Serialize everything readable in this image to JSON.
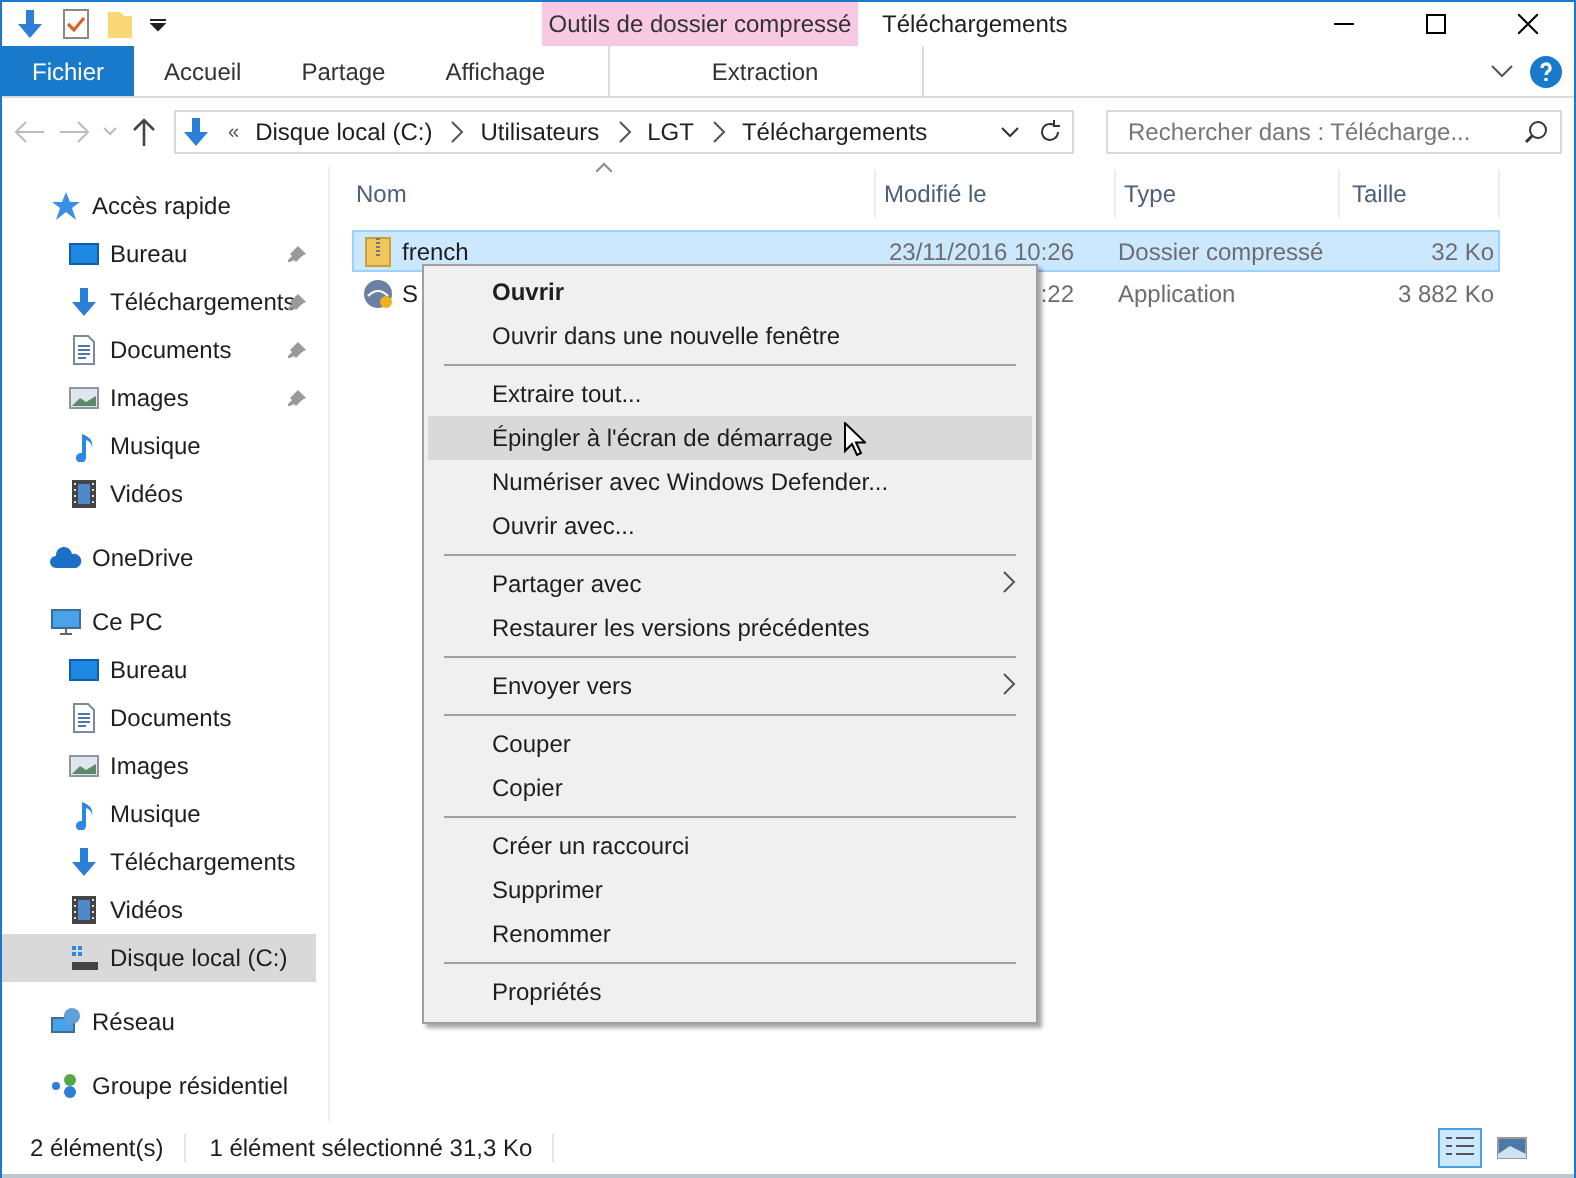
{
  "title_bar": {
    "context_group": "Outils de dossier compressé",
    "title": "Téléchargements"
  },
  "ribbon_tabs": [
    {
      "label": "Fichier",
      "kind": "file",
      "selected": false
    },
    {
      "label": "Accueil",
      "kind": "normal",
      "selected": false
    },
    {
      "label": "Partage",
      "kind": "normal",
      "selected": false
    },
    {
      "label": "Affichage",
      "kind": "normal",
      "selected": false
    },
    {
      "label": "Extraction",
      "kind": "context",
      "selected": false
    }
  ],
  "address_bar": {
    "prefix": "«",
    "crumbs": [
      "Disque local (C:)",
      "Utilisateurs",
      "LGT",
      "Téléchargements"
    ]
  },
  "search": {
    "placeholder": "Rechercher dans : Télécharge..."
  },
  "sidebar": [
    {
      "label": "Accès rapide",
      "kind": "star",
      "selected": false,
      "children": [
        {
          "label": "Bureau",
          "kind": "desktop",
          "pinned": true,
          "selected": false
        },
        {
          "label": "Téléchargements",
          "kind": "download",
          "pinned": true,
          "selected": false
        },
        {
          "label": "Documents",
          "kind": "document",
          "pinned": true,
          "selected": false
        },
        {
          "label": "Images",
          "kind": "image",
          "pinned": true,
          "selected": false
        },
        {
          "label": "Musique",
          "kind": "music",
          "pinned": false,
          "selected": false
        },
        {
          "label": "Vidéos",
          "kind": "video",
          "pinned": false,
          "selected": false
        }
      ]
    },
    {
      "label": "OneDrive",
      "kind": "cloud",
      "selected": false
    },
    {
      "label": "Ce PC",
      "kind": "pc",
      "selected": false,
      "children": [
        {
          "label": "Bureau",
          "kind": "desktop",
          "pinned": false,
          "selected": false
        },
        {
          "label": "Documents",
          "kind": "document",
          "pinned": false,
          "selected": false
        },
        {
          "label": "Images",
          "kind": "image",
          "pinned": false,
          "selected": false
        },
        {
          "label": "Musique",
          "kind": "music",
          "pinned": false,
          "selected": false
        },
        {
          "label": "Téléchargements",
          "kind": "download",
          "pinned": false,
          "selected": false
        },
        {
          "label": "Vidéos",
          "kind": "video",
          "pinned": false,
          "selected": false
        },
        {
          "label": "Disque local (C:)",
          "kind": "drive",
          "pinned": false,
          "selected": true
        }
      ]
    },
    {
      "label": "Réseau",
      "kind": "network",
      "selected": false
    },
    {
      "label": "Groupe résidentiel",
      "kind": "homegroup",
      "selected": false
    }
  ],
  "table": {
    "columns": [
      "Nom",
      "Modifié le",
      "Type",
      "Taille"
    ],
    "rows": [
      {
        "kind": "zip",
        "name": "french",
        "modified": "23/11/2016 10:26",
        "type": "Dossier compressé",
        "size": "32 Ko",
        "selected": true
      },
      {
        "kind": "app",
        "name": "S",
        "modified": ":22",
        "type": "Application",
        "size": "3 882 Ko",
        "selected": false
      }
    ]
  },
  "context_menu": [
    [
      {
        "label": "Ouvrir",
        "default": true,
        "submenu": false,
        "selected": false
      },
      {
        "label": "Ouvrir dans une nouvelle fenêtre",
        "default": false,
        "submenu": false,
        "selected": false
      }
    ],
    [
      {
        "label": "Extraire tout...",
        "default": false,
        "submenu": false,
        "selected": false
      },
      {
        "label": "Épingler à l'écran de démarrage",
        "default": false,
        "submenu": false,
        "selected": true
      },
      {
        "label": "Numériser avec Windows Defender...",
        "default": false,
        "submenu": false,
        "selected": false
      },
      {
        "label": "Ouvrir avec...",
        "default": false,
        "submenu": false,
        "selected": false
      }
    ],
    [
      {
        "label": "Partager avec",
        "default": false,
        "submenu": true,
        "selected": false
      },
      {
        "label": "Restaurer les versions précédentes",
        "default": false,
        "submenu": false,
        "selected": false
      }
    ],
    [
      {
        "label": "Envoyer vers",
        "default": false,
        "submenu": true,
        "selected": false
      }
    ],
    [
      {
        "label": "Couper",
        "default": false,
        "submenu": false,
        "selected": false
      },
      {
        "label": "Copier",
        "default": false,
        "submenu": false,
        "selected": false
      }
    ],
    [
      {
        "label": "Créer un raccourci",
        "default": false,
        "submenu": false,
        "selected": false
      },
      {
        "label": "Supprimer",
        "default": false,
        "submenu": false,
        "selected": false
      },
      {
        "label": "Renommer",
        "default": false,
        "submenu": false,
        "selected": false
      }
    ],
    [
      {
        "label": "Propriétés",
        "default": false,
        "submenu": false,
        "selected": false
      }
    ]
  ],
  "status_bar": {
    "count": "2 élément(s)",
    "selection": "1 élément sélectionné  31,3 Ko"
  },
  "view_buttons": [
    {
      "kind": "details",
      "selected": true
    },
    {
      "kind": "tiles",
      "selected": false
    }
  ]
}
